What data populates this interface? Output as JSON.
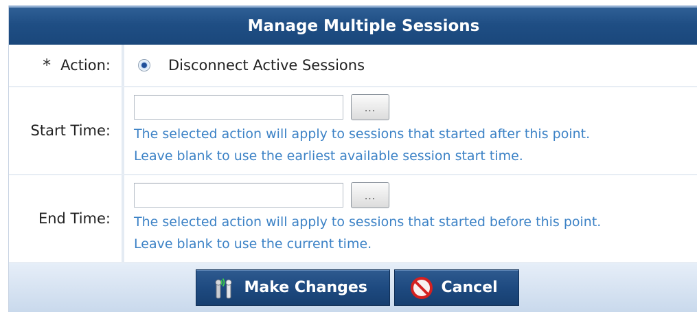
{
  "dialog": {
    "title": "Manage Multiple Sessions"
  },
  "action": {
    "required_marker": "*",
    "label": "Action:",
    "option_label": "Disconnect Active Sessions",
    "selected": true
  },
  "start_time": {
    "label": "Start Time:",
    "value": "",
    "picker_label": "...",
    "help_line1": "The selected action will apply to sessions that started after this point.",
    "help_line2": "Leave blank to use the earliest available session start time."
  },
  "end_time": {
    "label": "End Time:",
    "value": "",
    "picker_label": "...",
    "help_line1": "The selected action will apply to sessions that started before this point.",
    "help_line2": "Leave blank to use the current time."
  },
  "footer": {
    "make_changes_label": "Make Changes",
    "cancel_label": "Cancel"
  },
  "colors": {
    "header": "#1f4e84",
    "help_text": "#3c82c6",
    "cancel_icon": "#d42020"
  },
  "icons": {
    "make_changes": "wireless-antenna-icon",
    "cancel": "prohibited-icon"
  }
}
